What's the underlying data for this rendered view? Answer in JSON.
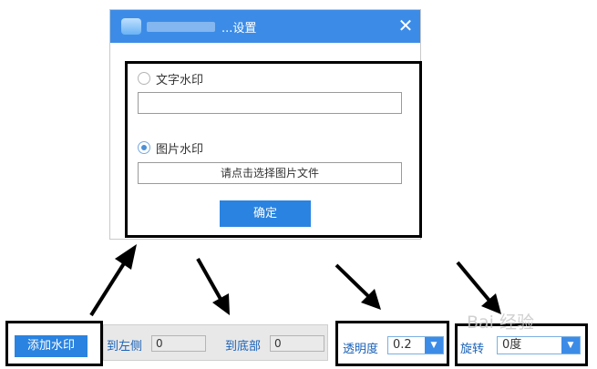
{
  "dialog": {
    "title": "...设置",
    "close_icon": "close-icon",
    "text_option_label": "文字水印",
    "text_input_value": "",
    "image_option_label": "图片水印",
    "choose_file_label": "请点击选择图片文件",
    "confirm_label": "确定",
    "selected_option": "image"
  },
  "toolbar": {
    "add_watermark_label": "添加水印",
    "left_label": "到左侧",
    "left_value": "0",
    "bottom_label": "到底部",
    "bottom_value": "0",
    "opacity_label": "透明度",
    "opacity_value": "0.2",
    "rotate_label": "旋转",
    "rotate_value": "0度"
  },
  "watermark": {
    "text": "Bai 经验"
  },
  "colors": {
    "accent": "#2a83e0",
    "titlebar": "#3c8ce7"
  }
}
